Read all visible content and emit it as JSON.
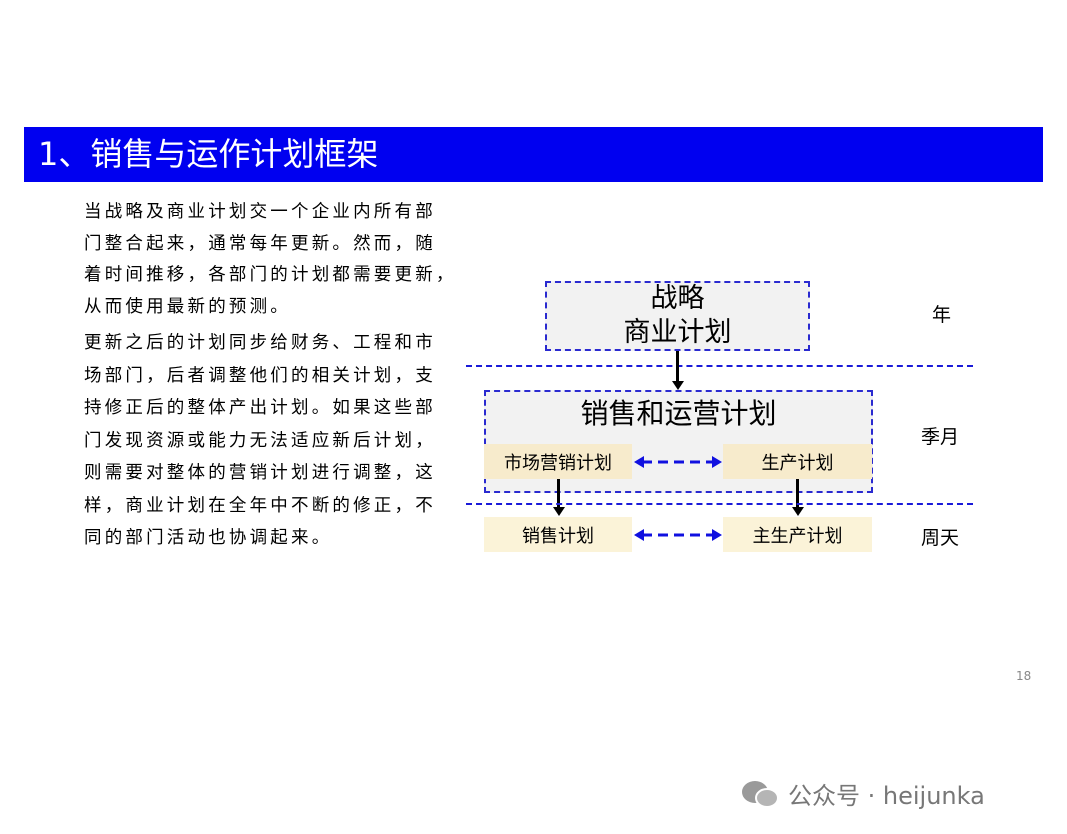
{
  "title": "1、销售与运作计划框架",
  "paragraphs": [
    [
      "当战略及商业计划交一个企业内所有部",
      "门整合起来，通常每年更新。然而，随",
      "着时间推移，各部门的计划都需要更新，",
      "从而使用最新的预测。"
    ],
    [
      "更新之后的计划同步给财务、工程和市",
      "场部门，后者调整他们的相关计划，支",
      "持修正后的整体产出计划。如果这些部",
      "门发现资源或能力无法适应新后计划，",
      "则需要对整体的营销计划进行调整，这",
      "样，商业计划在全年中不断的修正，不",
      "同的部门活动也协调起来。"
    ]
  ],
  "diagram": {
    "strategy": [
      "战略",
      "商业计划"
    ],
    "sop": "销售和运营计划",
    "marketing": "市场营销计划",
    "production": "生产计划",
    "sales": "销售计划",
    "mps": "主生产计划",
    "periods": [
      "年",
      "季月",
      "周天"
    ]
  },
  "page_number": "18",
  "watermark": "公众号 · heijunka",
  "colors": {
    "title_bar": "#0000f0",
    "dash": "#1a1ad8",
    "tan": "#f7ebcc"
  }
}
